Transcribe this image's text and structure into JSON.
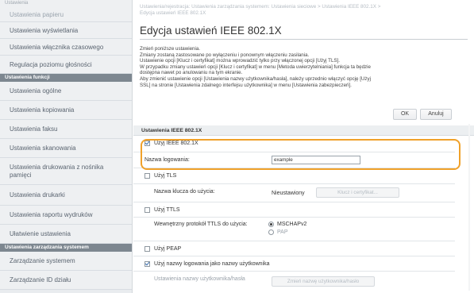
{
  "sidebar": {
    "top_faded": "Ustawienia",
    "items_a": [
      "Ustawienia papieru",
      "Ustawienia wyświetlania",
      "Ustawienia włącznika czasowego",
      "Regulacja poziomu głośności"
    ],
    "section_functions": "Ustawienia funkcji",
    "items_b": [
      "Ustawienia ogólne",
      "Ustawienia kopiowania",
      "Ustawienia faksu",
      "Ustawienia skanowania",
      "Ustawienia drukowania z nośnika pamięci",
      "Ustawienia drukarki",
      "Ustawienia raportu wydruków",
      "Ułatwienie ustawienia"
    ],
    "section_management": "Ustawienia zarządzania systemem",
    "items_c": [
      "Zarządzanie systemem",
      "Zarządzanie ID działu"
    ]
  },
  "main": {
    "breadcrumb_line1": "Ustawienia/rejestracja: Ustawienia zarządzania systemem: Ustawienia sieciowe > Ustawienia IEEE 802.1X >",
    "breadcrumb_line2": "Edycja ustawień IEEE 802.1X",
    "page_title": "Edycja ustawień IEEE 802.1X",
    "description": [
      "Zmień poniższe ustawienia.",
      "Zmiany zostaną zastosowane po wyłączeniu i ponownym włączeniu zasilania.",
      "Ustawienie opcji [Klucz i certyfikat] można wprowadzić tylko przy włączonej opcji [Użyj TLS].",
      "W przypadku zmiany ustawień opcji [Klucz i certyfikat] w menu [Metoda uwierzytelniania] funkcja ta będzie",
      "dostępna nawet po anulowaniu na tym ekranie.",
      "Aby zmienić ustawienie opcji [Ustawienia nazwy użytkownika/hasła], należy uprzednio włączyć opcję [Użyj",
      "SSL] na stronie [Ustawienia zdalnego interfejsu użytkownika] w menu [Ustawienia zabezpieczeń]."
    ],
    "ok_label": "OK",
    "cancel_label": "Anuluj",
    "section_title": "Ustawienia IEEE 802.1X",
    "use_ieee_label": "Użyj IEEE 802.1X",
    "use_ieee_checked": true,
    "login_name_label": "Nazwa logowania:",
    "login_name_value": "example",
    "use_tls_label": "Użyj TLS",
    "use_tls_checked": false,
    "key_name_label": "Nazwa klucza do użycia:",
    "key_name_value": "Nieustawiony",
    "key_cert_button": "Klucz i certyfikat...",
    "use_ttls_label": "Użyj TTLS",
    "use_ttls_checked": false,
    "ttls_protocol_label": "Wewnętrzny protokół TTLS do użycia:",
    "ttls_options": [
      "MSCHAPv2",
      "PAP"
    ],
    "ttls_selected": "MSCHAPv2",
    "use_peap_label": "Użyj PEAP",
    "use_peap_checked": false,
    "use_login_as_user_label": "Użyj nazwy logowania jako nazwy użytkownika",
    "use_login_as_user_checked": true,
    "user_pass_settings_label": "Ustawienia nazwy użytkownika/hasła",
    "change_user_pass_button": "Zmień nazwę użytkownika/hasło",
    "accent_color": "#f0a12a"
  }
}
